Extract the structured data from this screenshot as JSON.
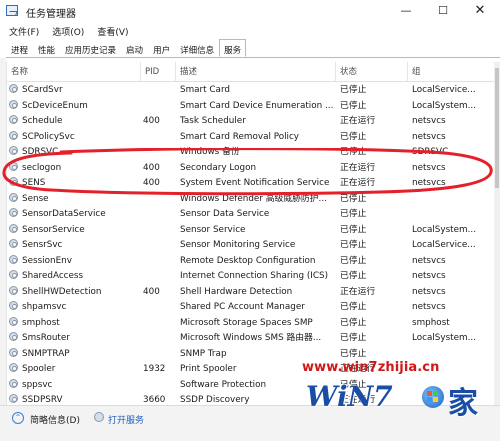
{
  "window": {
    "title": "任务管理器",
    "minimize_glyph": "—",
    "maximize_glyph": "☐",
    "close_glyph": "✕"
  },
  "menu": [
    {
      "label": "文件(F)"
    },
    {
      "label": "选项(O)"
    },
    {
      "label": "查看(V)"
    }
  ],
  "tabs": [
    {
      "label": "进程",
      "active": false
    },
    {
      "label": "性能",
      "active": false
    },
    {
      "label": "应用历史记录",
      "active": false
    },
    {
      "label": "启动",
      "active": false
    },
    {
      "label": "用户",
      "active": false
    },
    {
      "label": "详细信息",
      "active": false
    },
    {
      "label": "服务",
      "active": true
    }
  ],
  "columns": {
    "name": "名称",
    "pid": "PID",
    "description": "描述",
    "status": "状态",
    "group": "组"
  },
  "services": [
    {
      "name": "SCardSvr",
      "pid": "",
      "description": "Smart Card",
      "status": "已停止",
      "group": "LocalService..."
    },
    {
      "name": "ScDeviceEnum",
      "pid": "",
      "description": "Smart Card Device Enumeration ...",
      "status": "已停止",
      "group": "LocalSystem..."
    },
    {
      "name": "Schedule",
      "pid": "400",
      "description": "Task Scheduler",
      "status": "正在运行",
      "group": "netsvcs"
    },
    {
      "name": "SCPolicySvc",
      "pid": "",
      "description": "Smart Card Removal Policy",
      "status": "已停止",
      "group": "netsvcs"
    },
    {
      "name": "SDRSVC",
      "pid": "",
      "description": "Windows 备份",
      "status": "已停止",
      "group": "SDRSVC"
    },
    {
      "name": "seclogon",
      "pid": "400",
      "description": "Secondary Logon",
      "status": "正在运行",
      "group": "netsvcs"
    },
    {
      "name": "SENS",
      "pid": "400",
      "description": "System Event Notification Service",
      "status": "正在运行",
      "group": "netsvcs"
    },
    {
      "name": "Sense",
      "pid": "",
      "description": "Windows Defender 高级威胁防护...",
      "status": "已停止",
      "group": ""
    },
    {
      "name": "SensorDataService",
      "pid": "",
      "description": "Sensor Data Service",
      "status": "已停止",
      "group": ""
    },
    {
      "name": "SensorService",
      "pid": "",
      "description": "Sensor Service",
      "status": "已停止",
      "group": "LocalSystem..."
    },
    {
      "name": "SensrSvc",
      "pid": "",
      "description": "Sensor Monitoring Service",
      "status": "已停止",
      "group": "LocalService..."
    },
    {
      "name": "SessionEnv",
      "pid": "",
      "description": "Remote Desktop Configuration",
      "status": "已停止",
      "group": "netsvcs"
    },
    {
      "name": "SharedAccess",
      "pid": "",
      "description": "Internet Connection Sharing (ICS)",
      "status": "已停止",
      "group": "netsvcs"
    },
    {
      "name": "ShellHWDetection",
      "pid": "400",
      "description": "Shell Hardware Detection",
      "status": "正在运行",
      "group": "netsvcs"
    },
    {
      "name": "shpamsvc",
      "pid": "",
      "description": "Shared PC Account Manager",
      "status": "已停止",
      "group": "netsvcs"
    },
    {
      "name": "smphost",
      "pid": "",
      "description": "Microsoft Storage Spaces SMP",
      "status": "已停止",
      "group": "smphost"
    },
    {
      "name": "SmsRouter",
      "pid": "",
      "description": "Microsoft Windows SMS 路由器...",
      "status": "已停止",
      "group": "LocalSystem..."
    },
    {
      "name": "SNMPTRAP",
      "pid": "",
      "description": "SNMP Trap",
      "status": "已停止",
      "group": ""
    },
    {
      "name": "Spooler",
      "pid": "1932",
      "description": "Print Spooler",
      "status": "正在运行",
      "group": ""
    },
    {
      "name": "sppsvc",
      "pid": "",
      "description": "Software Protection",
      "status": "已停止",
      "group": ""
    },
    {
      "name": "SSDPSRV",
      "pid": "3660",
      "description": "SSDP Discovery",
      "status": "正在运行",
      "group": ""
    }
  ],
  "footer": {
    "brief_label": "简略信息(D)",
    "open_services_label": "打开服务"
  },
  "watermark": {
    "url": "www.win7zhijia.cn",
    "logo": "WiN7",
    "home": "家"
  },
  "colors": {
    "highlight_ink": "#e4202a",
    "link": "#1f5fbf",
    "watermark_red": "#d01818",
    "watermark_blue": "#1a4ea6"
  }
}
